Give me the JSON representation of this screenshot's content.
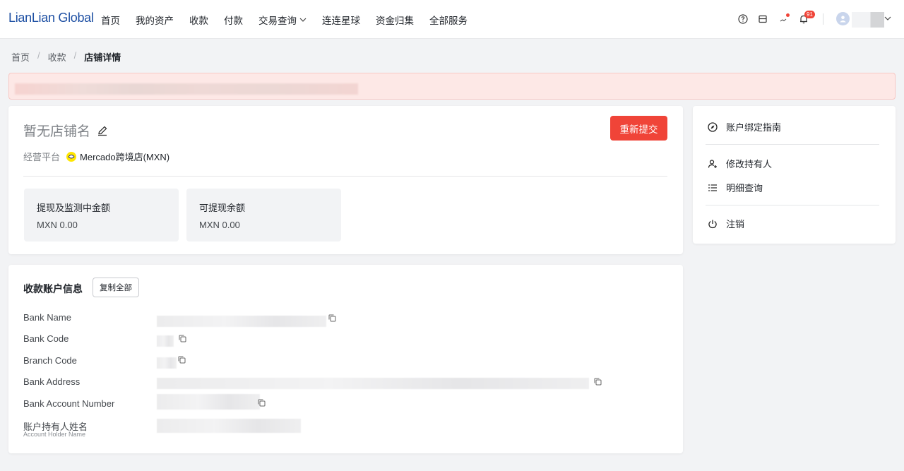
{
  "header": {
    "logo": "LianLian Global",
    "nav": [
      {
        "label": "首页"
      },
      {
        "label": "我的资产"
      },
      {
        "label": "收款"
      },
      {
        "label": "付款"
      },
      {
        "label": "交易查询",
        "dropdown": true
      },
      {
        "label": "连连星球"
      },
      {
        "label": "资金归集"
      },
      {
        "label": "全部服务"
      }
    ],
    "notification_count": "91",
    "icons": [
      "help-circle-icon",
      "storefront-icon",
      "trend-icon",
      "bell-icon",
      "avatar-icon",
      "chevron-down-icon"
    ]
  },
  "breadcrumb": {
    "items": [
      "首页",
      "收款"
    ],
    "current": "店铺详情"
  },
  "shop": {
    "name": "暂无店铺名",
    "resubmit_label": "重新提交",
    "platform_label": "经营平台",
    "platform_value": "Mercado跨境店(MXN)",
    "stats": [
      {
        "title": "提现及监测中金额",
        "value": "MXN 0.00"
      },
      {
        "title": "可提现余额",
        "value": "MXN 0.00"
      }
    ]
  },
  "sidebar": {
    "items": [
      {
        "label": "账户绑定指南",
        "icon": "compass-icon"
      },
      {
        "label": "修改持有人",
        "icon": "user-plus-icon"
      },
      {
        "label": "明细查询",
        "icon": "list-icon"
      },
      {
        "label": "注销",
        "icon": "power-icon"
      }
    ]
  },
  "account": {
    "title": "收款账户信息",
    "copy_all_label": "复制全部",
    "fields": [
      {
        "label": "Bank Name"
      },
      {
        "label": "Bank Code"
      },
      {
        "label": "Branch Code"
      },
      {
        "label": "Bank Address"
      },
      {
        "label": "Bank Account Number"
      },
      {
        "label": "账户持有人姓名",
        "sublabel": "Account Holder Name"
      }
    ]
  },
  "colors": {
    "accent_red": "#f04438",
    "brand_blue": "#1d4fa3",
    "alert_bg": "#fde8e6"
  }
}
